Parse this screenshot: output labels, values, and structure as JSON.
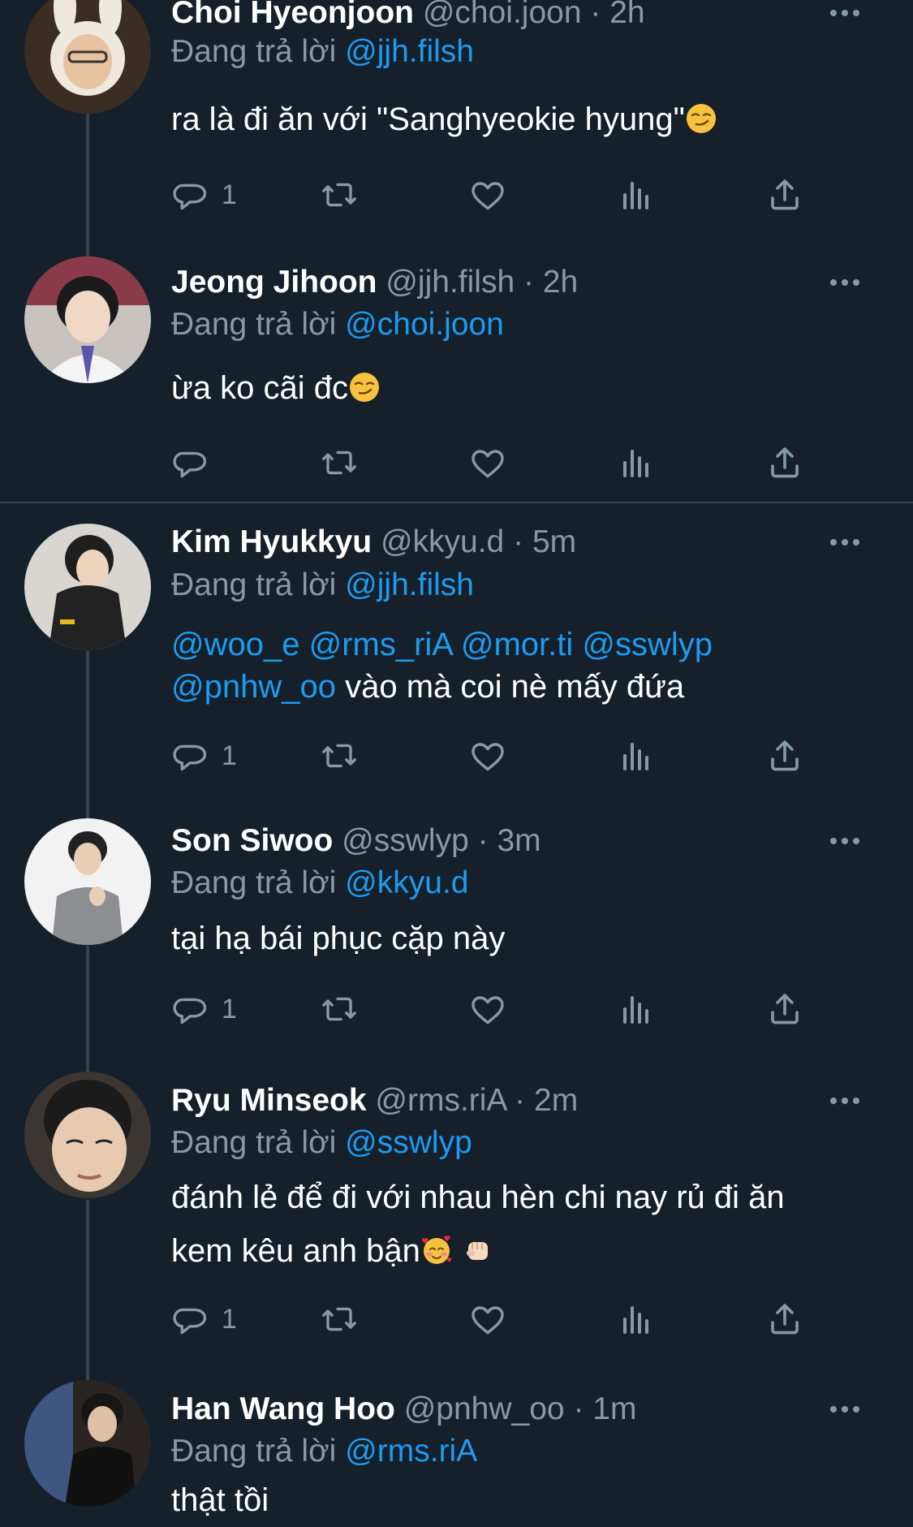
{
  "reply_prefix": "Đang trả lời",
  "colors": {
    "background": "#15202b",
    "mention": "#1d9bf0",
    "muted": "#8899a6",
    "line": "#38444d"
  },
  "tweets": [
    {
      "name": "Choi Hyeonjoon",
      "handle": "@choi.joon",
      "time": "2h",
      "replying_to": "@jjh.filsh",
      "text": "ra là đi ăn với \"Sanghyeokie hyung\"",
      "emojis": [
        "smirk-emoji"
      ],
      "reply_count": "1"
    },
    {
      "name": "Jeong Jihoon",
      "handle": "@jjh.filsh",
      "time": "2h",
      "replying_to": "@choi.joon",
      "text": "ừa ko cãi đc",
      "emojis": [
        "smirk-emoji"
      ],
      "reply_count": ""
    },
    {
      "name": "Kim Hyukkyu",
      "handle": "@kkyu.d",
      "time": "5m",
      "replying_to": "@jjh.filsh",
      "mentions_line1": "@woo_e @rms_riA @mor.ti @sswlyp",
      "mention_line2": "@pnhw_oo",
      "text_line2": " vào mà coi nè mấy đứa",
      "reply_count": "1"
    },
    {
      "name": "Son Siwoo",
      "handle": "@sswlyp",
      "time": "3m",
      "replying_to": "@kkyu.d",
      "text": "tại hạ bái phục cặp này",
      "reply_count": "1"
    },
    {
      "name": "Ryu Minseok",
      "handle": "@rms.riA",
      "time": "2m",
      "replying_to": "@sswlyp",
      "text_line1": "đánh lẻ để đi với nhau hèn chi nay rủ đi ăn",
      "text_line2": "kem kêu anh bận",
      "emojis": [
        "smiling-hearts-emoji",
        "fist-bump-emoji"
      ],
      "reply_count": "1"
    },
    {
      "name": "Han Wang Hoo",
      "handle": "@pnhw_oo",
      "time": "1m",
      "replying_to": "@rms.riA",
      "text": "thật tồi"
    }
  ]
}
